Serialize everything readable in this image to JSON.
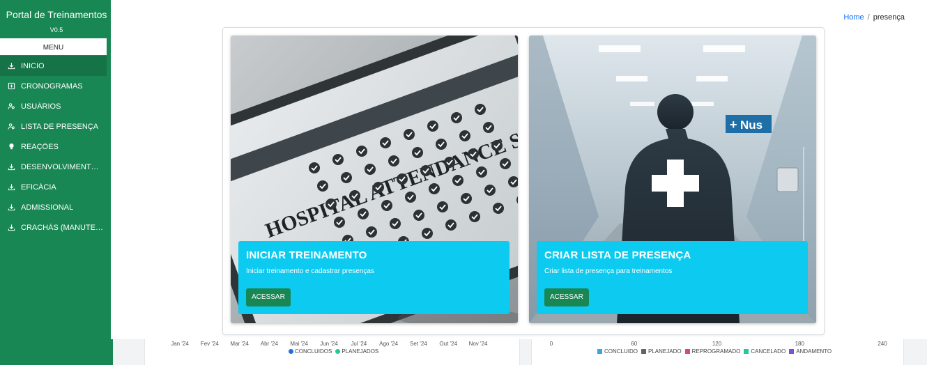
{
  "sidebar": {
    "title": "Portal de Treinamentos",
    "version": "V0.5",
    "menu_label": "MENU",
    "items": [
      {
        "label": "INICIO",
        "icon": "download-icon"
      },
      {
        "label": "CRONOGRAMAS",
        "icon": "plus-square-icon"
      },
      {
        "label": "USUÁRIOS",
        "icon": "users-icon"
      },
      {
        "label": "LISTA DE PRESENÇA",
        "icon": "users-icon"
      },
      {
        "label": "REAÇÕES",
        "icon": "lightbulb-icon"
      },
      {
        "label": "DESENVOLVIMENTO (...",
        "icon": "download-icon"
      },
      {
        "label": "EFICÁCIA",
        "icon": "download-icon"
      },
      {
        "label": "ADMISSIONAL",
        "icon": "download-icon"
      },
      {
        "label": "CRACHÁS (MANUTEN...",
        "icon": "download-icon"
      }
    ]
  },
  "breadcrumb": {
    "home": "Home",
    "separator": "/",
    "current": "presença"
  },
  "cards": [
    {
      "image_heading": "HOSPITAL ATTENDANCE SHEET",
      "title": "INICIAR TREINAMENTO",
      "description": "Iniciar treinamento e cadastrar presenças",
      "button": "ACESSAR"
    },
    {
      "image_sign": "Nus",
      "title": "CRIAR LISTA DE PRESENÇA",
      "description": "Criar lista de presença para treinamentos",
      "button": "ACESSAR"
    }
  ],
  "chart_left": {
    "x_ticks": [
      "Jan '24",
      "Fev '24",
      "Mar '24",
      "Abr '24",
      "Mai '24",
      "Jun '24",
      "Jul '24",
      "Ago '24",
      "Set '24",
      "Out '24",
      "Nov '24"
    ],
    "legend": [
      {
        "name": "CONCLUIDOS",
        "color": "#1f6fe5"
      },
      {
        "name": "PLANEJADOS",
        "color": "#20c997"
      }
    ]
  },
  "chart_right": {
    "x_ticks": [
      "0",
      "60",
      "120",
      "180",
      "240"
    ],
    "legend": [
      {
        "name": "CONCLUIDO",
        "color": "#3aa6e0"
      },
      {
        "name": "PLANEJADO",
        "color": "#5a6672"
      },
      {
        "name": "REPROGRAMADO",
        "color": "#dc4c64"
      },
      {
        "name": "CANCELADO",
        "color": "#20c9a0"
      },
      {
        "name": "ANDAMENTO",
        "color": "#7b4fd8"
      }
    ]
  },
  "colors": {
    "sidebar": "#198754",
    "card_overlay": "#0dcaf0",
    "button": "#198754",
    "link": "#0d6efd"
  }
}
